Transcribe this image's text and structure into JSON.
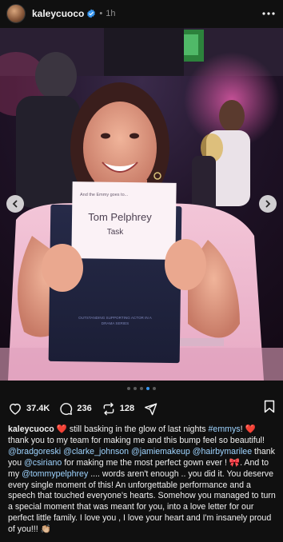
{
  "post": {
    "username": "kaleycuoco",
    "time_ago": "1h",
    "separator": "•"
  },
  "icons": {
    "verified": "verified-badge-icon",
    "more": "more-horizontal-icon",
    "prev": "chevron-left-icon",
    "next": "chevron-right-icon",
    "like": "heart-icon",
    "comment": "comment-icon",
    "repost": "repost-icon",
    "share": "send-icon",
    "bookmark": "bookmark-icon"
  },
  "photo": {
    "card_header": "And the Emmy goes to...",
    "card_name": "Tom Pelphrey",
    "card_title": "Task",
    "folder_text_1": "OUTSTANDING SUPPORTING ACTOR IN A",
    "folder_text_2": "DRAMA SERIES"
  },
  "carousel": {
    "pages": 5,
    "active_index": 3
  },
  "stats": {
    "likes": "37.4K",
    "comments": "236",
    "reposts": "128"
  },
  "caption": {
    "username": "kaleycuoco",
    "emoji_heart": "❤️",
    "part1": " still basking in the glow of last nights ",
    "hashtag": "#emmys",
    "part2": "! ",
    "part3": " thank you to my team for making me and this bump feel so beautiful! ",
    "m1": "@bradgoreski",
    "m2": "@clarke_johnson",
    "m3": "@jamiemakeup",
    "m4": "@hairbymarilee",
    "part4": " thank you ",
    "m5": "@csiriano",
    "part5": " for making me the most perfect gown ever ! ",
    "emoji_bow": "🎀",
    "part6": ". And to my ",
    "m6": "@tommypelphrey",
    "part7": " .... words aren't enough .. you did it. You deserve every single moment of this! An unforgettable performance and a speech that touched everyone's hearts. Somehow you managed to turn a special moment that was meant for you, into a love letter for our perfect little family. I love you , I love your heart and I'm insanely proud of you!!! ",
    "emoji_clap": "👏🏼"
  },
  "colors": {
    "background": "#101010",
    "accent_blue": "#3897f0",
    "mention": "#9fd4ff",
    "muted": "#8e8e8e"
  }
}
